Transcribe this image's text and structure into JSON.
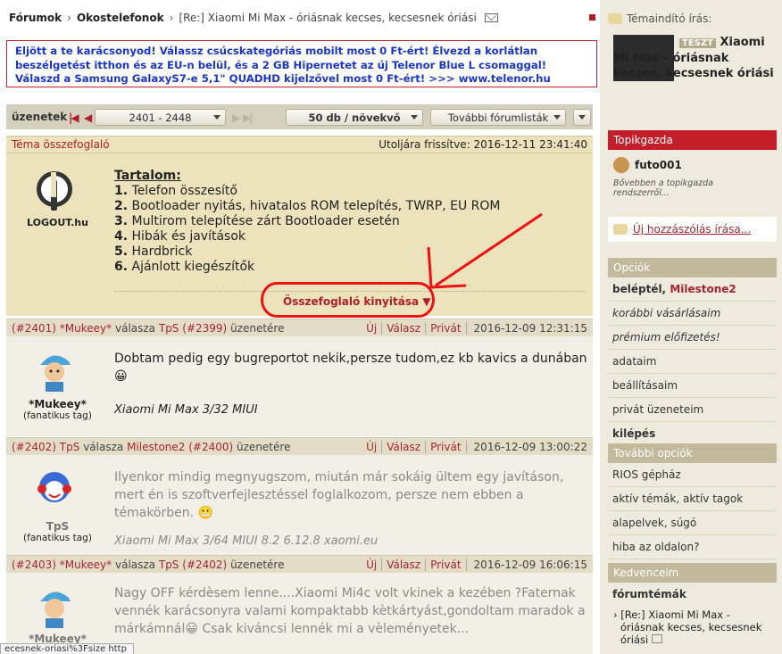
{
  "breadcrumb": {
    "forums": "Fórumok",
    "section": "Okostelefonok",
    "title": "[Re:] Xiaomi Mi Max - óriásnak kecses, kecsesnek óriási"
  },
  "ad": {
    "text": "Eljött a te karácsonyod! Válassz csúcskategóriás mobilt most 0 Ft-ért! Élvezd a korlátlan beszélgetést itthon és az EU-n belül, és a 2 GB Hipernetet az új Telenor Blue L csomaggal! Válaszd a Samsung GalaxyS7-e 5,1\" QUADHD kijelzővel most 0 Ft-ért! >>> www.telenor.hu"
  },
  "toolbar": {
    "label": "üzenetek",
    "range": "2401 - 2448",
    "perpage": "50 db / növekvő",
    "more": "További fórumlisták"
  },
  "summary": {
    "title": "Téma összefoglaló",
    "updated": "Utoljára frissítve: 2016-12-11 23:41:40",
    "logo": "LOGOUT.hu",
    "toc_title": "Tartalom:",
    "items": [
      {
        "n": "1.",
        "t": "Telefon összesítő"
      },
      {
        "n": "2.",
        "t": "Bootloader nyitás, hivatalos ROM telepítés, TWRP, EU ROM"
      },
      {
        "n": "3.",
        "t": "Multirom telepítése zárt Bootloader esetén"
      },
      {
        "n": "4.",
        "t": "Hibák és javítások"
      },
      {
        "n": "5.",
        "t": "Hardbrick"
      },
      {
        "n": "6.",
        "t": "Ajánlott kiegészítők"
      }
    ],
    "open": "Összefoglaló kinyitása ▼"
  },
  "posts": [
    {
      "id": "(#2401)",
      "user": "*Mukeey*",
      "mid": "válasza",
      "to": "TpS",
      "toid": "(#2399)",
      "end": "üzenetére",
      "new": "Új",
      "reply": "Válasz",
      "priv": "Privát",
      "date": "2016-12-09 12:31:15",
      "name": "*Mukeey*",
      "role": "(fanatikus tag)",
      "text": "Dobtam pedig egy bugreportot nekik,persze tudom,ez kb kavics a dunában😀",
      "sig": "Xiaomi Mi Max 3/32 MIUI"
    },
    {
      "id": "(#2402)",
      "user": "TpS",
      "mid": "válasza",
      "to": "Milestone2",
      "toid": "(#2400)",
      "end": "üzenetére",
      "new": "Új",
      "reply": "Válasz",
      "priv": "Privát",
      "date": "2016-12-09 13:00:22",
      "name": "TpS",
      "role": "(fanatikus tag)",
      "text": "Ilyenkor mindig megnyugszom, miután már sokáig ültem egy javításon, mert én is szoftverfejlesztéssel foglalkozom, persze nem ebben a témakörben. 😬",
      "sig": "Xiaomi Mi Max 3/64 MIUI 8.2 6.12.8 xaomi.eu"
    },
    {
      "id": "(#2403)",
      "user": "*Mukeey*",
      "mid": "válasza",
      "to": "TpS",
      "toid": "(#2402)",
      "end": "üzenetére",
      "new": "Új",
      "reply": "Válasz",
      "priv": "Privát",
      "date": "2016-12-09 16:06:15",
      "name": "*Mukeey*",
      "role": "",
      "text": "Nagy OFF kérdèsem lenne....Xiaomi Mi4c volt vkinek a kezében ?Faternak vennék karácsonyra valami kompaktabb kètkártyást,gondoltam maradok a márkámnál😀 Csak kiváncsi lennék mi a vèleményetek...",
      "sig": ""
    }
  ],
  "status": "ecesnek-oriasi%3Fsize http",
  "sidebar": {
    "starter_label": "Témaindító írás:",
    "badge": "TESZT",
    "starter_title": "Xiaomi Mi Max - óriásnak kecses, kecsesnek óriási",
    "host_head": "Topikgazda",
    "host": "futo001",
    "host_more": "Bővebben a topikgazda rendszerről...",
    "new_post": "Új hozzászólás írása...",
    "opt_head": "Opciók",
    "login": "beléptél,",
    "login_user": "Milestone2",
    "opts": [
      "korábbi vásárlásaim",
      "prémium előfizetés!",
      "adataim",
      "beállításaim",
      "privát üzeneteim",
      "kilépés"
    ],
    "more_head": "További opciók",
    "more": [
      "RIOS gépház",
      "aktív témák, aktív tagok",
      "alapelvek, súgó",
      "hiba az oldalon?"
    ],
    "fav_head": "Kedvenceim",
    "fav_sub": "fórumtémák",
    "fav_item": "[Re:] Xiaomi Mi Max - óriásnak kecses, kecsesnek óriási"
  }
}
